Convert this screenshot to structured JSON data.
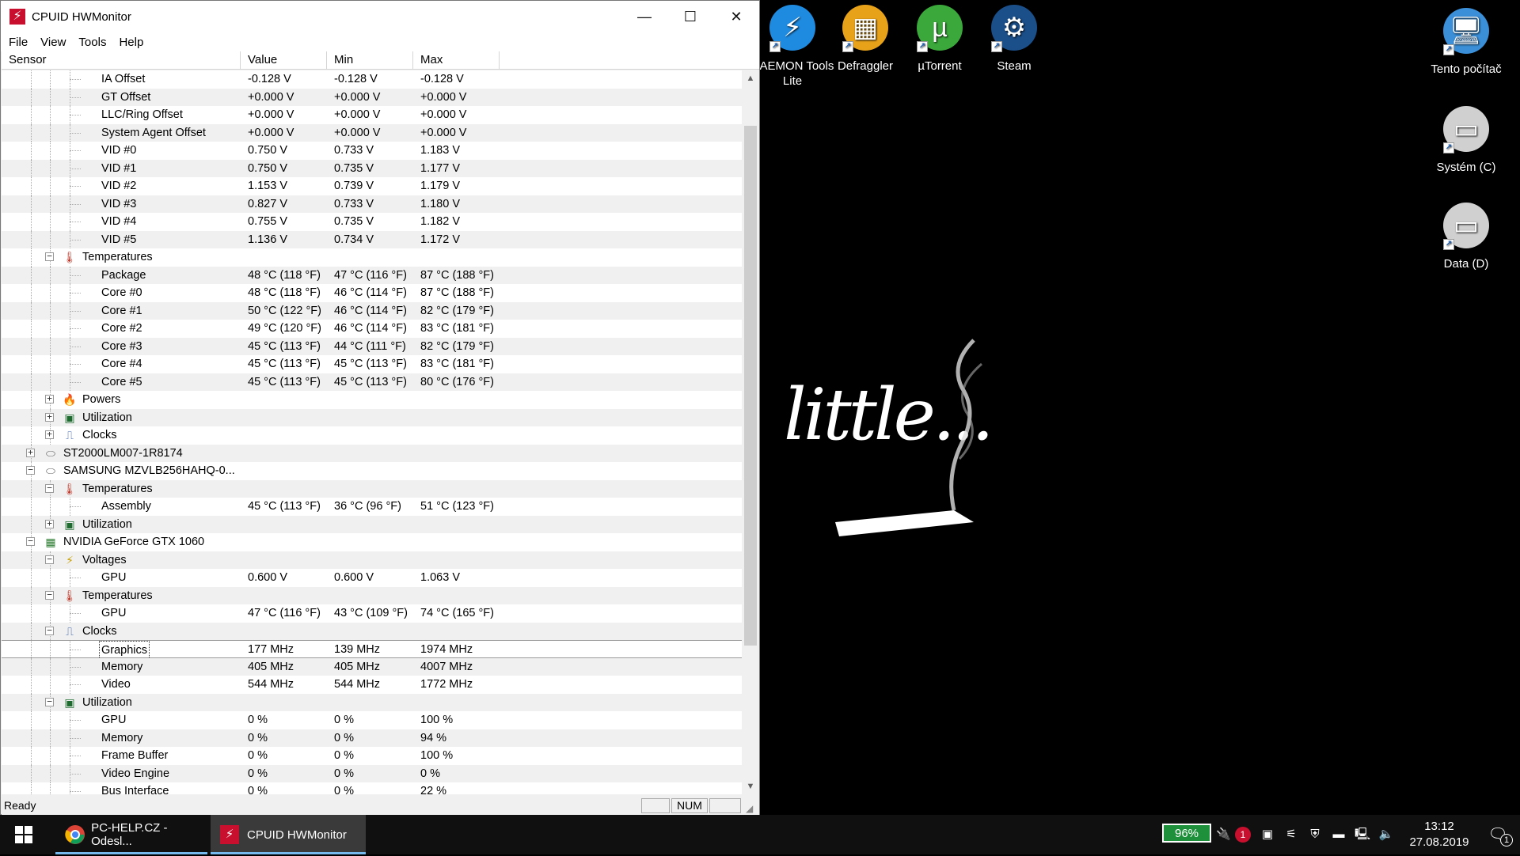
{
  "window": {
    "title": "CPUID HWMonitor",
    "minimize": "—",
    "maximize": "☐",
    "close": "✕",
    "app_icon": "⚡"
  },
  "menu": [
    "File",
    "View",
    "Tools",
    "Help"
  ],
  "columns": [
    "Sensor",
    "Value",
    "Min",
    "Max"
  ],
  "rows": [
    {
      "level": 3,
      "label": "IA Offset",
      "value": "-0.128 V",
      "min": "-0.128 V",
      "max": "-0.128 V"
    },
    {
      "level": 3,
      "label": "GT Offset",
      "value": "+0.000 V",
      "min": "+0.000 V",
      "max": "+0.000 V"
    },
    {
      "level": 3,
      "label": "LLC/Ring Offset",
      "value": "+0.000 V",
      "min": "+0.000 V",
      "max": "+0.000 V"
    },
    {
      "level": 3,
      "label": "System Agent Offset",
      "value": "+0.000 V",
      "min": "+0.000 V",
      "max": "+0.000 V"
    },
    {
      "level": 3,
      "label": "VID #0",
      "value": "0.750 V",
      "min": "0.733 V",
      "max": "1.183 V"
    },
    {
      "level": 3,
      "label": "VID #1",
      "value": "0.750 V",
      "min": "0.735 V",
      "max": "1.177 V"
    },
    {
      "level": 3,
      "label": "VID #2",
      "value": "1.153 V",
      "min": "0.739 V",
      "max": "1.179 V"
    },
    {
      "level": 3,
      "label": "VID #3",
      "value": "0.827 V",
      "min": "0.733 V",
      "max": "1.180 V"
    },
    {
      "level": 3,
      "label": "VID #4",
      "value": "0.755 V",
      "min": "0.735 V",
      "max": "1.182 V"
    },
    {
      "level": 3,
      "label": "VID #5",
      "value": "1.136 V",
      "min": "0.734 V",
      "max": "1.172 V"
    },
    {
      "level": 2,
      "label": "Temperatures",
      "expander": "−",
      "icon": "thermometer-icon",
      "value": "",
      "min": "",
      "max": ""
    },
    {
      "level": 3,
      "label": "Package",
      "value": "48 °C  (118 °F)",
      "min": "47 °C  (116 °F)",
      "max": "87 °C  (188 °F)"
    },
    {
      "level": 3,
      "label": "Core #0",
      "value": "48 °C  (118 °F)",
      "min": "46 °C  (114 °F)",
      "max": "87 °C  (188 °F)"
    },
    {
      "level": 3,
      "label": "Core #1",
      "value": "50 °C  (122 °F)",
      "min": "46 °C  (114 °F)",
      "max": "82 °C  (179 °F)"
    },
    {
      "level": 3,
      "label": "Core #2",
      "value": "49 °C  (120 °F)",
      "min": "46 °C  (114 °F)",
      "max": "83 °C  (181 °F)"
    },
    {
      "level": 3,
      "label": "Core #3",
      "value": "45 °C  (113 °F)",
      "min": "44 °C  (111 °F)",
      "max": "82 °C  (179 °F)"
    },
    {
      "level": 3,
      "label": "Core #4",
      "value": "45 °C  (113 °F)",
      "min": "45 °C  (113 °F)",
      "max": "83 °C  (181 °F)"
    },
    {
      "level": 3,
      "label": "Core #5",
      "value": "45 °C  (113 °F)",
      "min": "45 °C  (113 °F)",
      "max": "80 °C  (176 °F)"
    },
    {
      "level": 2,
      "label": "Powers",
      "expander": "+",
      "icon": "power-icon",
      "value": "",
      "min": "",
      "max": ""
    },
    {
      "level": 2,
      "label": "Utilization",
      "expander": "+",
      "icon": "utilization-icon",
      "value": "",
      "min": "",
      "max": ""
    },
    {
      "level": 2,
      "label": "Clocks",
      "expander": "+",
      "icon": "clock-icon",
      "value": "",
      "min": "",
      "max": ""
    },
    {
      "level": 1,
      "label": "ST2000LM007-1R8174",
      "expander": "+",
      "icon": "drive-icon",
      "value": "",
      "min": "",
      "max": ""
    },
    {
      "level": 1,
      "label": "SAMSUNG MZVLB256HAHQ-0...",
      "expander": "−",
      "icon": "drive-icon",
      "value": "",
      "min": "",
      "max": ""
    },
    {
      "level": 2,
      "label": "Temperatures",
      "expander": "−",
      "icon": "thermometer-icon",
      "value": "",
      "min": "",
      "max": ""
    },
    {
      "level": 3,
      "label": "Assembly",
      "value": "45 °C  (113 °F)",
      "min": "36 °C  (96 °F)",
      "max": "51 °C  (123 °F)"
    },
    {
      "level": 2,
      "label": "Utilization",
      "expander": "+",
      "icon": "utilization-icon",
      "value": "",
      "min": "",
      "max": ""
    },
    {
      "level": 1,
      "label": "NVIDIA GeForce GTX 1060",
      "expander": "−",
      "icon": "gpu-icon",
      "value": "",
      "min": "",
      "max": ""
    },
    {
      "level": 2,
      "label": "Voltages",
      "expander": "−",
      "icon": "voltage-icon",
      "value": "",
      "min": "",
      "max": ""
    },
    {
      "level": 3,
      "label": "GPU",
      "value": "0.600 V",
      "min": "0.600 V",
      "max": "1.063 V"
    },
    {
      "level": 2,
      "label": "Temperatures",
      "expander": "−",
      "icon": "thermometer-icon",
      "value": "",
      "min": "",
      "max": ""
    },
    {
      "level": 3,
      "label": "GPU",
      "value": "47 °C  (116 °F)",
      "min": "43 °C  (109 °F)",
      "max": "74 °C  (165 °F)"
    },
    {
      "level": 2,
      "label": "Clocks",
      "expander": "−",
      "icon": "clock-icon",
      "value": "",
      "min": "",
      "max": ""
    },
    {
      "level": 3,
      "label": "Graphics",
      "value": "177 MHz",
      "min": "139 MHz",
      "max": "1974 MHz",
      "selected": true
    },
    {
      "level": 3,
      "label": "Memory",
      "value": "405 MHz",
      "min": "405 MHz",
      "max": "4007 MHz"
    },
    {
      "level": 3,
      "label": "Video",
      "value": "544 MHz",
      "min": "544 MHz",
      "max": "1772 MHz"
    },
    {
      "level": 2,
      "label": "Utilization",
      "expander": "−",
      "icon": "utilization-icon",
      "value": "",
      "min": "",
      "max": ""
    },
    {
      "level": 3,
      "label": "GPU",
      "value": "0 %",
      "min": "0 %",
      "max": "100 %"
    },
    {
      "level": 3,
      "label": "Memory",
      "value": "0 %",
      "min": "0 %",
      "max": "94 %"
    },
    {
      "level": 3,
      "label": "Frame Buffer",
      "value": "0 %",
      "min": "0 %",
      "max": "100 %"
    },
    {
      "level": 3,
      "label": "Video Engine",
      "value": "0 %",
      "min": "0 %",
      "max": "0 %"
    },
    {
      "level": 3,
      "label": "Bus Interface",
      "value": "0 %",
      "min": "0 %",
      "max": "22 %"
    }
  ],
  "status": {
    "text": "Ready",
    "num": "NUM"
  },
  "desktop_icons": [
    {
      "label": "DAEMON Tools Lite",
      "icon": "daemon-tools-icon",
      "color": "#1f8be0",
      "glyph": "⚡"
    },
    {
      "label": "Defraggler",
      "icon": "defraggler-icon",
      "color": "#e8a21a",
      "glyph": "▦"
    },
    {
      "label": "µTorrent",
      "icon": "utorrent-icon",
      "color": "#3ba83b",
      "glyph": "µ"
    },
    {
      "label": "Steam",
      "icon": "steam-icon",
      "color": "#1b4f8a",
      "glyph": "⚙"
    },
    {
      "label": "Tento počítač",
      "icon": "computer-icon",
      "color": "#3a8fd8",
      "glyph": "🖥"
    },
    {
      "label": "Systém (C)",
      "icon": "drive-c-icon",
      "color": "#d0d0d0",
      "glyph": "▭"
    },
    {
      "label": "Data (D)",
      "icon": "drive-d-icon",
      "color": "#d0d0d0",
      "glyph": "▭"
    }
  ],
  "wallpaper_text": "little...",
  "taskbar": {
    "start_icon": "windows-start-icon",
    "apps": [
      {
        "label": "PC-HELP.CZ - Odesl...",
        "icon": "chrome-icon",
        "active": false
      },
      {
        "label": "CPUID HWMonitor",
        "icon": "hwmonitor-icon",
        "active": true
      }
    ],
    "battery": "96%",
    "badge": "1",
    "time": "13:12",
    "date": "27.08.2019",
    "notifications": "1"
  }
}
